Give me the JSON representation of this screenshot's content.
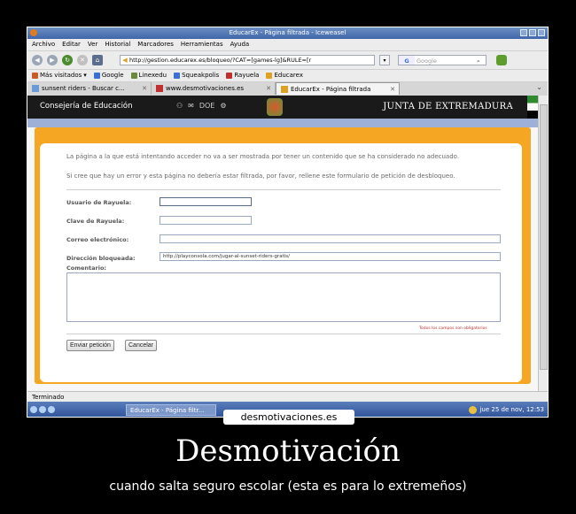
{
  "window": {
    "title": "EducarEx - Página filtrada - Iceweasel"
  },
  "menu": [
    "Archivo",
    "Editar",
    "Ver",
    "Historial",
    "Marcadores",
    "Herramientas",
    "Ayuda"
  ],
  "nav": {
    "url": "http://gestion.educarex.es/bloqueo/?CAT=[games-lg]&RULE=[r",
    "search_placeholder": "Google",
    "search_engine": "G"
  },
  "bookmarks": [
    {
      "label": "Más visitados",
      "color": "#c85a2a"
    },
    {
      "label": "Google",
      "color": "#3a6fd8"
    },
    {
      "label": "Linexedu",
      "color": "#6a8a3a"
    },
    {
      "label": "Squeakpolis",
      "color": "#3a6fd8"
    },
    {
      "label": "Rayuela",
      "color": "#c03030"
    },
    {
      "label": "Educarex",
      "color": "#e0a020"
    }
  ],
  "tabs": [
    {
      "label": "sunsent riders - Buscar c...",
      "active": false
    },
    {
      "label": "www.desmotivaciones.es",
      "active": false
    },
    {
      "label": "EducarEx - Página filtrada",
      "active": true
    }
  ],
  "site": {
    "left_header": "Consejería de Educación",
    "doe": "DOE",
    "right_header": "JUNTA DE EXTREMADURA"
  },
  "page": {
    "message1": "La página a la que está intentando acceder no va a ser mostrada por tener un contenido que se ha considerado no adecuado.",
    "message2": "Si cree que hay un error y esta página no debería estar filtrada, por favor, rellene este formulario de petición de desbloqueo.",
    "fields": {
      "usuario_label": "Usuario de Rayuela:",
      "clave_label": "Clave de Rayuela:",
      "correo_label": "Correo electrónico:",
      "direccion_label": "Dirección bloqueada:",
      "direccion_value": "http://playconsola.com/jugar-al-sunset-riders-gratis/",
      "comentario_label": "Comentario:"
    },
    "required_note": "Todos los campos son obligatorios",
    "submit_label": "Enviar petición",
    "cancel_label": "Cancelar"
  },
  "status": "Terminado",
  "taskbar": {
    "task_label": "EducarEx - Página filtr...",
    "clock": "jue 25 de nov, 12:53"
  },
  "poster": {
    "watermark": "desmotivaciones.es",
    "title": "Desmotivación",
    "subtitle": "cuando salta seguro escolar (esta es para lo extremeños)"
  }
}
